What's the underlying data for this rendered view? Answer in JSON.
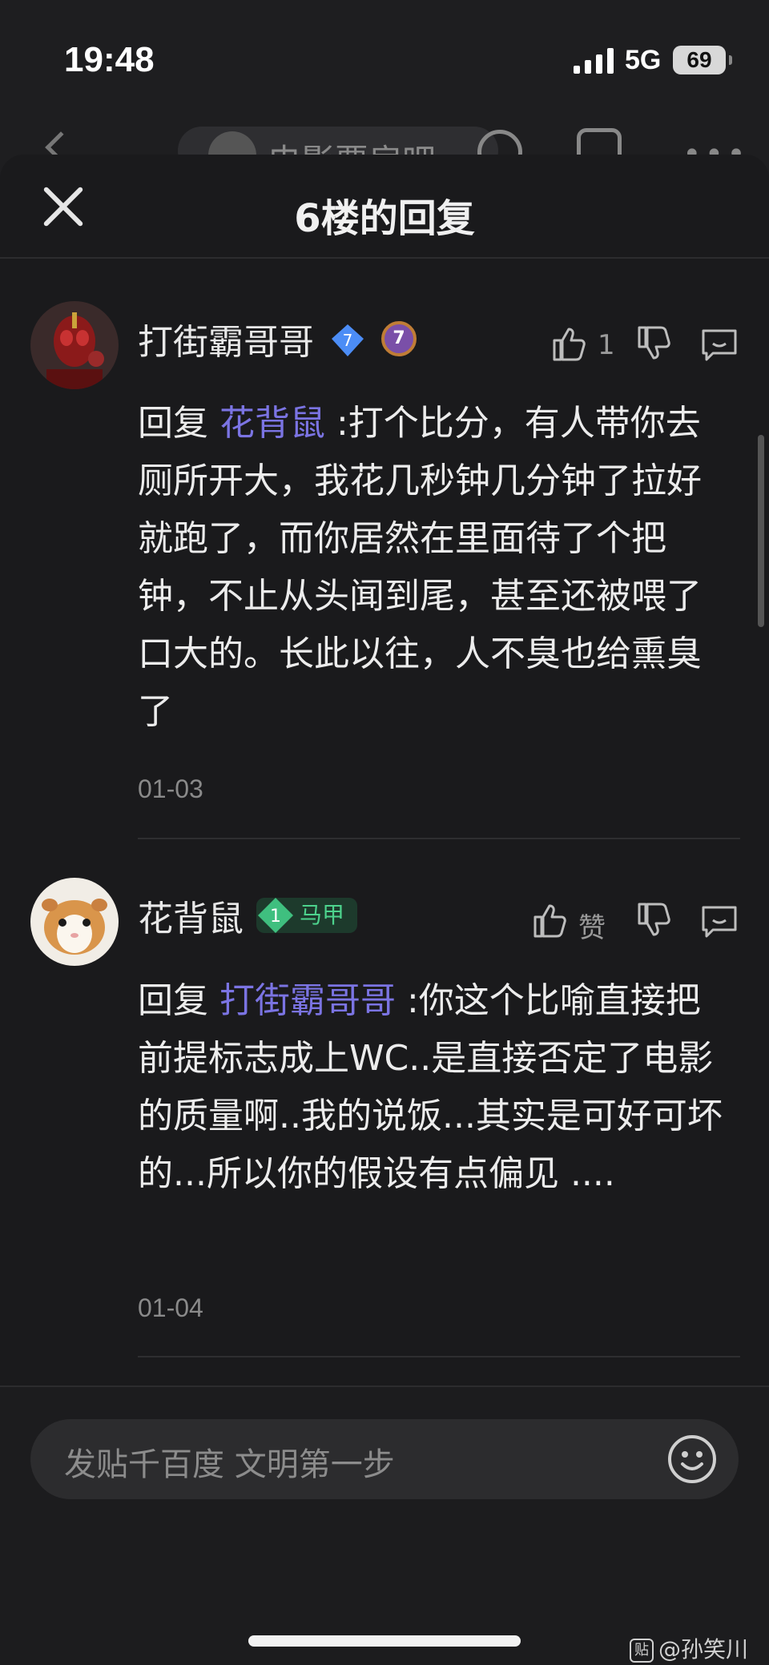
{
  "status_bar": {
    "time": "19:48",
    "network": "5G",
    "battery": "69"
  },
  "behind_nav": {
    "forum_name": "电影票房吧"
  },
  "sheet": {
    "title": "6楼的回复"
  },
  "comments": [
    {
      "username": "打街霸哥哥",
      "level_badge": "7",
      "like_count": "1",
      "reply_prefix": "回复 ",
      "mention": "花背鼠",
      "text": " :打个比分，有人带你去厕所开大，我花几秒钟几分钟了拉好就跑了，而你居然在里面待了个把钟，不止从头闻到尾，甚至还被喂了口大的。长此以往，人不臭也给熏臭了",
      "date": "01-03"
    },
    {
      "username": "花背鼠",
      "level": "1",
      "tag": "马甲",
      "like_label": "赞",
      "reply_prefix": "回复 ",
      "mention": "打街霸哥哥",
      "text": " :你这个比喻直接把前提标志成上WC..是直接否定了电影的质量啊..我的说饭...其实是可好可坏的...所以你的假设有点偏见 ....",
      "date": "01-04"
    }
  ],
  "input": {
    "placeholder": "发贴千百度 文明第一步"
  },
  "watermark": {
    "icon": "贴",
    "text": "@孙笑川吧"
  },
  "colors": {
    "mention": "#7b74e3",
    "tag_green": "#4dd38d",
    "background": "#1a1a1c"
  }
}
